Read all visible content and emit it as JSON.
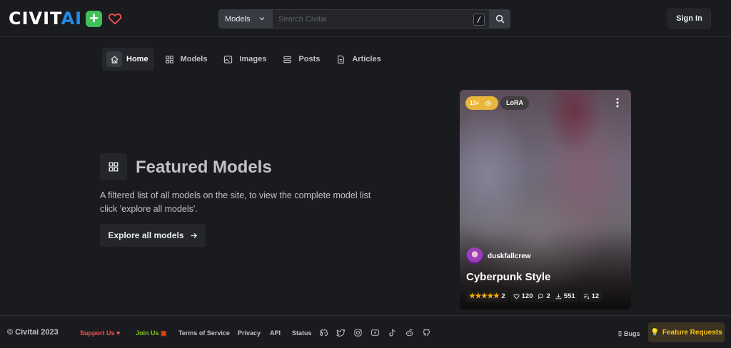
{
  "header": {
    "logo_prefix": "CIVIT",
    "logo_suffix": "AI",
    "search_category": "Models",
    "search_placeholder": "Search Civitai",
    "search_shortcut": "/",
    "sign_in_label": "Sign In"
  },
  "nav": {
    "items": [
      {
        "label": "Home",
        "icon": "home-icon",
        "active": true
      },
      {
        "label": "Models",
        "icon": "grid-icon"
      },
      {
        "label": "Images",
        "icon": "photo-icon"
      },
      {
        "label": "Posts",
        "icon": "layers-icon"
      },
      {
        "label": "Articles",
        "icon": "file-text-icon"
      }
    ]
  },
  "hero": {
    "title": "Featured Models",
    "description": "A filtered list of all models on the site, to view the complete model list click 'explore all models'.",
    "explore_label": "Explore all models"
  },
  "card": {
    "rating_badge": "13+",
    "type_badge": "LoRA",
    "username": "duskfallcrew",
    "title": "Cyberpunk Style",
    "stars": 5,
    "rating_count": "2",
    "likes": "120",
    "comments": "2",
    "downloads": "551",
    "versions": "12"
  },
  "footer": {
    "copyright": "© Civitai 2023",
    "support": "Support Us",
    "join": "Join Us",
    "terms": "Terms of Service",
    "privacy": "Privacy",
    "api": "API",
    "status": "Status",
    "bugs": "Bugs",
    "feature_requests": "Feature Requests",
    "socials": [
      "discord-icon",
      "twitter-icon",
      "instagram-icon",
      "youtube-icon",
      "tiktok-icon",
      "reddit-icon",
      "github-icon"
    ]
  },
  "colors": {
    "background": "#1a1b1e",
    "logo_plus": "#40c057",
    "logo_heart": "#fa5252",
    "rating_badge": "#e8b63a",
    "stars": "#fab005",
    "support": "#fa5252",
    "join": "#82c91e",
    "feature": "#fcc419"
  }
}
